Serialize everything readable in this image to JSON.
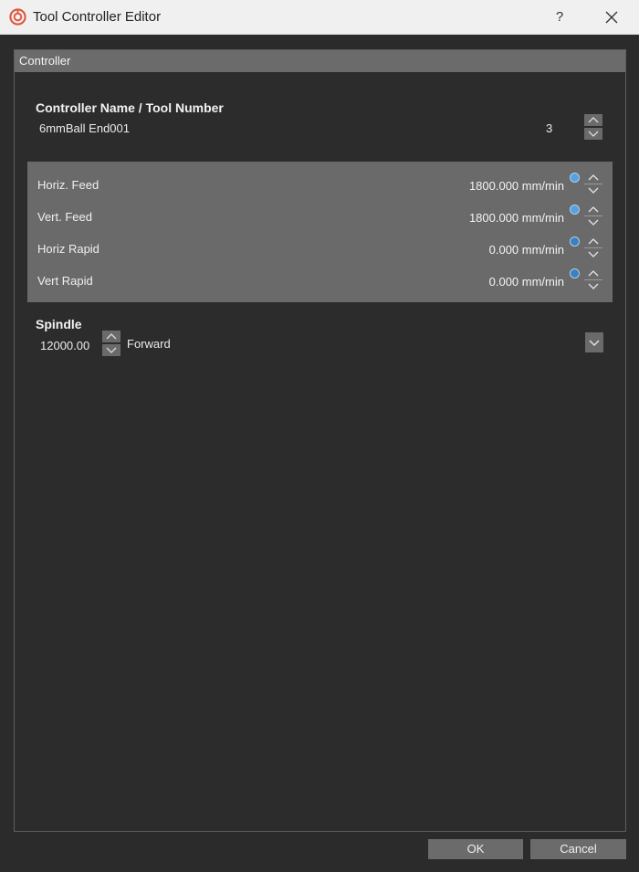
{
  "window": {
    "title": "Tool Controller Editor",
    "help_label": "?"
  },
  "section": {
    "header": "Controller"
  },
  "controller": {
    "name_label": "Controller Name /  Tool Number",
    "name_value": "6mmBall End001",
    "tool_number": "3"
  },
  "feeds": [
    {
      "label": "Horiz. Feed",
      "value": "1800.000 mm/min"
    },
    {
      "label": "Vert. Feed",
      "value": "1800.000 mm/min"
    },
    {
      "label": "Horiz Rapid",
      "value": "0.000 mm/min"
    },
    {
      "label": "Vert Rapid",
      "value": "0.000 mm/min"
    }
  ],
  "spindle": {
    "label": "Spindle",
    "speed": "12000.00",
    "direction": "Forward"
  },
  "buttons": {
    "ok": "OK",
    "cancel": "Cancel"
  },
  "colors": {
    "background": "#2b2b2b",
    "panel": "#6a6a6a",
    "icon_accent": "#e2543a"
  }
}
